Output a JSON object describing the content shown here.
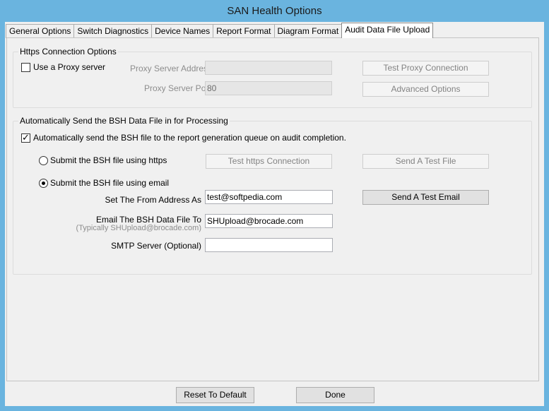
{
  "window": {
    "title": "SAN Health Options"
  },
  "tabs": [
    {
      "label": "General Options"
    },
    {
      "label": "Switch Diagnostics"
    },
    {
      "label": "Device Names"
    },
    {
      "label": "Report Format"
    },
    {
      "label": "Diagram Format"
    },
    {
      "label": "Audit Data File Upload"
    }
  ],
  "https_group": {
    "title": "Https Connection Options",
    "use_proxy_label": "Use a Proxy server",
    "use_proxy_checked": false,
    "proxy_address_label": "Proxy Server Address",
    "proxy_address_value": "",
    "proxy_port_label": "Proxy Server Port",
    "proxy_port_value": "80",
    "test_proxy_button": "Test Proxy Connection",
    "advanced_button": "Advanced Options"
  },
  "auto_group": {
    "title": "Automatically Send the BSH Data File in for Processing",
    "auto_send_label": "Automatically send the BSH file to the report generation queue on audit completion.",
    "auto_send_checked": true,
    "https_radio_label": "Submit the BSH file using https",
    "https_radio_selected": false,
    "test_https_button": "Test https Connection",
    "send_test_file_button": "Send A Test File",
    "email_radio_label": "Submit the BSH file using email",
    "email_radio_selected": true,
    "from_label": "Set The From Address As",
    "from_value": "test@softpedia.com",
    "send_test_email_button": "Send  A Test Email",
    "to_label": "Email The BSH Data File To",
    "to_sublabel": "(Typically SHUpload@brocade.com)",
    "to_value": "SHUpload@brocade.com",
    "smtp_label": "SMTP Server (Optional)",
    "smtp_value": ""
  },
  "footer": {
    "reset_button": "Reset To Default",
    "done_button": "Done"
  }
}
